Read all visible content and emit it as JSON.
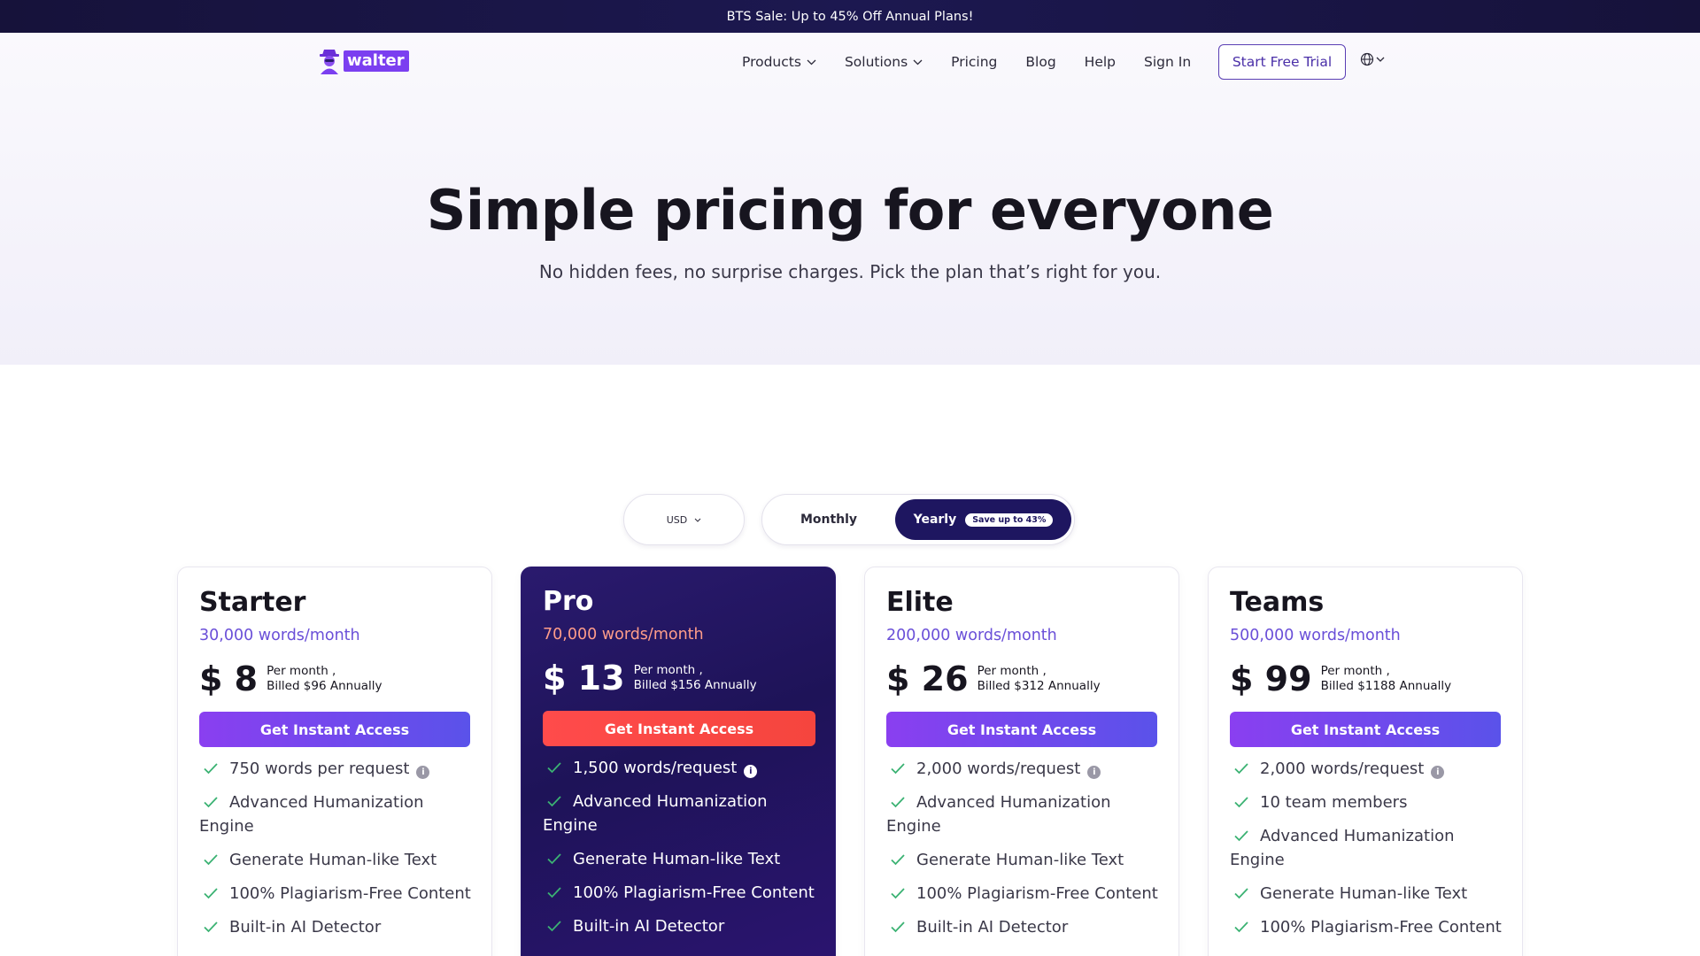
{
  "banner": {
    "text": "BTS Sale: Up to 45% Off Annual Plans!"
  },
  "brand": {
    "name": "walter"
  },
  "nav": {
    "items": [
      {
        "label": "Products",
        "has_dropdown": true
      },
      {
        "label": "Solutions",
        "has_dropdown": true
      },
      {
        "label": "Pricing",
        "has_dropdown": false
      },
      {
        "label": "Blog",
        "has_dropdown": false
      },
      {
        "label": "Help",
        "has_dropdown": false
      },
      {
        "label": "Sign In",
        "has_dropdown": false
      }
    ],
    "trial_button": "Start Free Trial",
    "language_icon": "globe-icon"
  },
  "hero": {
    "title": "Simple pricing for everyone",
    "subtitle": "No hidden fees, no surprise charges. Pick the plan that’s right for you."
  },
  "controls": {
    "currency": "USD",
    "period_monthly": "Monthly",
    "period_yearly": "Yearly",
    "save_badge": "Save up to 43%",
    "selected_period": "Yearly"
  },
  "colors": {
    "brand_purple": "#7b3ff0",
    "banner_navy": "#16123a",
    "pro_card": "#2a1a6e",
    "pro_cta": "#ff4b4b",
    "check_green": "#3bb273",
    "words_purple": "#6a4fd8"
  },
  "plans": [
    {
      "name": "Starter",
      "words": "30,000 words/month",
      "price": "$ 8",
      "per": "Per month ,",
      "billed": "Billed $96 Annually",
      "cta": "Get Instant Access",
      "features": [
        {
          "text": "750 words per request",
          "info": true
        },
        {
          "text": "Advanced Humanization Engine",
          "info": false
        },
        {
          "text": "Generate Human-like Text",
          "info": false
        },
        {
          "text": "100% Plagiarism-Free Content",
          "info": false
        },
        {
          "text": "Built-in AI Detector",
          "info": false
        }
      ]
    },
    {
      "name": "Pro",
      "words": "70,000 words/month",
      "price": "$ 13",
      "per": "Per month ,",
      "billed": "Billed $156 Annually",
      "cta": "Get Instant Access",
      "features": [
        {
          "text": "1,500 words/request",
          "info": true
        },
        {
          "text": "Advanced Humanization Engine",
          "info": false
        },
        {
          "text": "Generate Human-like Text",
          "info": false
        },
        {
          "text": "100% Plagiarism-Free Content",
          "info": false
        },
        {
          "text": "Built-in AI Detector",
          "info": false
        }
      ]
    },
    {
      "name": "Elite",
      "words": "200,000 words/month",
      "price": "$ 26",
      "per": "Per month ,",
      "billed": "Billed $312 Annually",
      "cta": "Get Instant Access",
      "features": [
        {
          "text": "2,000 words/request",
          "info": true
        },
        {
          "text": "Advanced Humanization Engine",
          "info": false
        },
        {
          "text": "Generate Human-like Text",
          "info": false
        },
        {
          "text": "100% Plagiarism-Free Content",
          "info": false
        },
        {
          "text": "Built-in AI Detector",
          "info": false
        }
      ]
    },
    {
      "name": "Teams",
      "words": "500,000 words/month",
      "price": "$ 99",
      "per": "Per month ,",
      "billed": "Billed $1188 Annually",
      "cta": "Get Instant Access",
      "features": [
        {
          "text": "2,000 words/request",
          "info": true
        },
        {
          "text": "10 team members",
          "info": false
        },
        {
          "text": "Advanced Humanization Engine",
          "info": false
        },
        {
          "text": "Generate Human-like Text",
          "info": false
        },
        {
          "text": "100% Plagiarism-Free Content",
          "info": false
        }
      ]
    }
  ]
}
